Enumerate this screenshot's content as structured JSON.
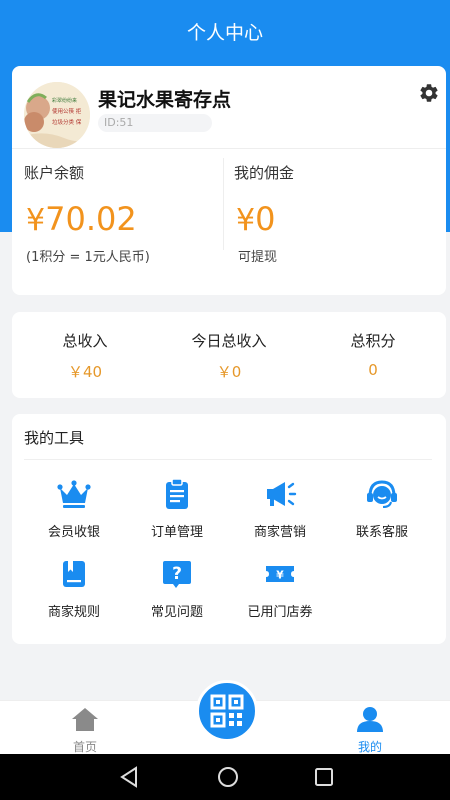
{
  "header": {
    "title": "个人中心"
  },
  "profile": {
    "name": "果记水果寄存点",
    "id_label": "ID:51",
    "avatar_lines": [
      "彩翠纷纷来",
      "使用公筷 拒",
      "垃圾分类 保"
    ]
  },
  "balance": {
    "account_label": "账户余额",
    "currency": "¥",
    "account_value": "70.02",
    "account_note": "(1积分 = 1元人民币)",
    "commission_label": "我的佣金",
    "commission_value": "0",
    "commission_note": "可提现"
  },
  "stats": [
    {
      "label": "总收入",
      "value": "￥40"
    },
    {
      "label": "今日总收入",
      "value": "￥0"
    },
    {
      "label": "总积分",
      "value": "0"
    }
  ],
  "tools": {
    "title": "我的工具",
    "items": [
      {
        "label": "会员收银",
        "icon": "crown-icon"
      },
      {
        "label": "订单管理",
        "icon": "clipboard-icon"
      },
      {
        "label": "商家营销",
        "icon": "megaphone-icon"
      },
      {
        "label": "联系客服",
        "icon": "headset-icon"
      },
      {
        "label": "商家规则",
        "icon": "rulebook-icon"
      },
      {
        "label": "常见问题",
        "icon": "question-icon"
      },
      {
        "label": "已用门店券",
        "icon": "ticket-icon"
      }
    ]
  },
  "nav": {
    "home_label": "首页",
    "mine_label": "我的",
    "active_color": "#1a8cf0",
    "inactive_color": "#888888"
  },
  "colors": {
    "primary": "#1a8cf0",
    "amount": "#f2931d"
  }
}
